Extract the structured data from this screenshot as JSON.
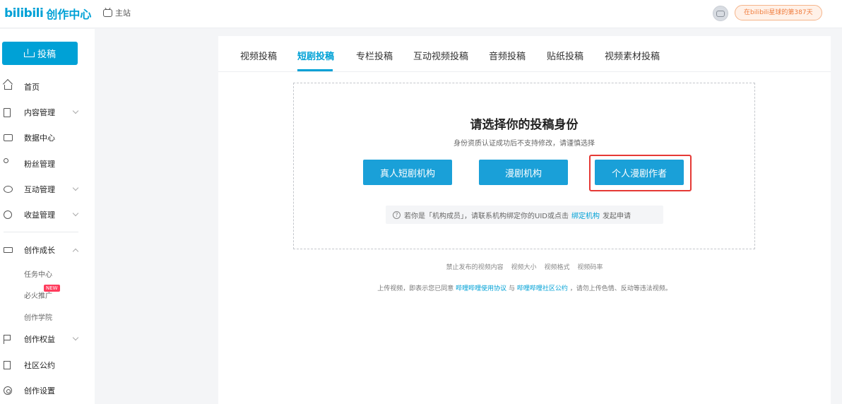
{
  "header": {
    "logo_mark": "bilibili",
    "logo_text": "创作中心",
    "home_label": "主站",
    "days_badge": "在bilibili星球的第387天"
  },
  "sidebar": {
    "upload_label": "投稿",
    "items": [
      {
        "label": "首页",
        "icon": "home-icon"
      },
      {
        "label": "内容管理",
        "icon": "document-icon"
      },
      {
        "label": "数据中心",
        "icon": "chart-icon"
      },
      {
        "label": "粉丝管理",
        "icon": "fans-icon"
      },
      {
        "label": "互动管理",
        "icon": "chat-icon"
      },
      {
        "label": "收益管理",
        "icon": "coin-icon"
      },
      {
        "label": "创作成长",
        "icon": "graduation-cap-icon"
      },
      {
        "label": "创作权益",
        "icon": "flag-icon"
      },
      {
        "label": "社区公约",
        "icon": "book-icon"
      },
      {
        "label": "创作设置",
        "icon": "settings-icon"
      }
    ],
    "growth_subitems": [
      "任务中心",
      "必火推广",
      "创作学院"
    ],
    "new_badge": "NEW"
  },
  "tabs": [
    "视频投稿",
    "短剧投稿",
    "专栏投稿",
    "互动视频投稿",
    "音频投稿",
    "贴纸投稿",
    "视频素材投稿"
  ],
  "active_tab": "短剧投稿",
  "identity": {
    "title": "请选择你的投稿身份",
    "subtitle": "身份资质认证成功后不支持修改，请谨慎选择",
    "options": [
      "真人短剧机构",
      "漫剧机构",
      "个人漫剧作者"
    ],
    "hint_prefix": "若你是「机构成员」，请联系机构绑定你的UID或点击",
    "hint_link": "绑定机构",
    "hint_suffix": "发起申请"
  },
  "footer": {
    "links": [
      "禁止发布的视频内容",
      "视频大小",
      "视频格式",
      "视频码率"
    ],
    "agreement_prefix": "上传视频，即表示您已同意",
    "agreement_link1": "哔哩哔哩使用协议",
    "agreement_mid": "与",
    "agreement_link2": "哔哩哔哩社区公约",
    "agreement_suffix": "，请勿上传色情、反动等违法视频。"
  },
  "colors": {
    "brand": "#00a1d6",
    "highlight_border": "#e53935"
  }
}
